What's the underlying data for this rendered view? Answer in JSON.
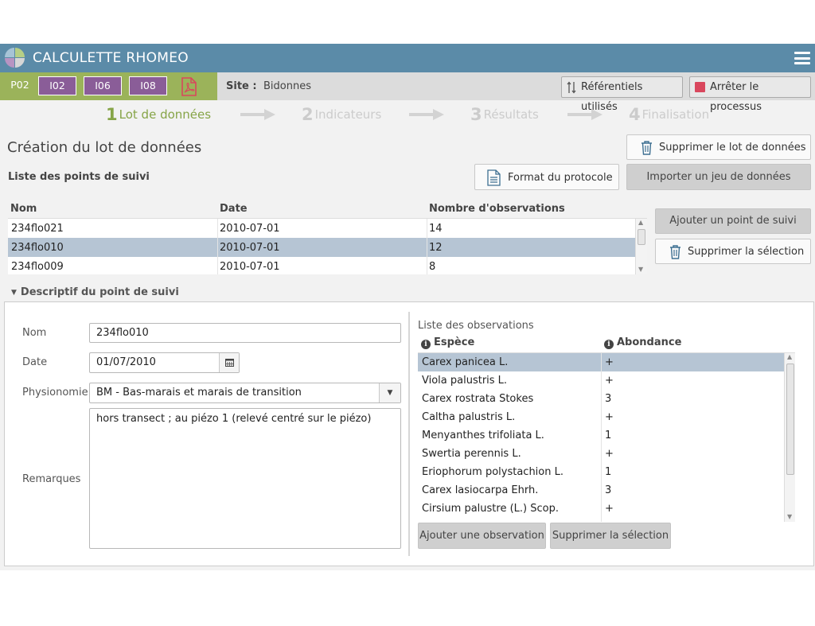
{
  "app": {
    "title": "CALCULETTE RHOMEO"
  },
  "toolbar": {
    "site_code": "P02",
    "indicators": [
      "I02",
      "I06",
      "I08"
    ],
    "site_label": "Site :",
    "site_value": "Bidonnes",
    "referentiels_label": "Référentiels utilisés",
    "stop_label": "Arrêter le processus"
  },
  "steps": [
    {
      "num": "1",
      "label": "Lot de données",
      "active": true
    },
    {
      "num": "2",
      "label": "Indicateurs",
      "active": false
    },
    {
      "num": "3",
      "label": "Résultats",
      "active": false
    },
    {
      "num": "4",
      "label": "Finalisation",
      "active": false
    }
  ],
  "page": {
    "title": "Création du lot de données",
    "delete_lot_label": "Supprimer le lot de données",
    "list_title": "Liste des points de suivi",
    "format_label": "Format du protocole",
    "import_label": "Importer un jeu de données",
    "add_point_label": "Ajouter un point de suivi",
    "delete_selection_label": "Supprimer la sélection"
  },
  "table": {
    "columns": [
      "Nom",
      "Date",
      "Nombre d'observations"
    ],
    "rows": [
      {
        "nom": "234flo021",
        "date": "2010-07-01",
        "nb": "14"
      },
      {
        "nom": "234flo010",
        "date": "2010-07-01",
        "nb": "12"
      },
      {
        "nom": "234flo009",
        "date": "2010-07-01",
        "nb": "8"
      }
    ],
    "selected_index": 1
  },
  "descriptif": {
    "title": "Descriptif du point de suivi",
    "nom_label": "Nom",
    "nom_value": "234flo010",
    "date_label": "Date",
    "date_value": "01/07/2010",
    "physio_label": "Physionomie",
    "physio_value": "BM - Bas-marais et marais de transition",
    "remarques_label": "Remarques",
    "remarques_value": "hors transect ; au piézo 1 (relevé centré sur le piézo)"
  },
  "observations": {
    "title": "Liste des observations",
    "col_espece": "Espèce",
    "col_abondance": "Abondance",
    "rows": [
      {
        "espece": "Carex panicea L.",
        "abondance": "+"
      },
      {
        "espece": "Viola palustris L.",
        "abondance": "+"
      },
      {
        "espece": "Carex rostrata Stokes",
        "abondance": "3"
      },
      {
        "espece": "Caltha palustris L.",
        "abondance": "+"
      },
      {
        "espece": "Menyanthes trifoliata L.",
        "abondance": "1"
      },
      {
        "espece": "Swertia perennis L.",
        "abondance": "+"
      },
      {
        "espece": "Eriophorum polystachion L.",
        "abondance": "1"
      },
      {
        "espece": "Carex lasiocarpa Ehrh.",
        "abondance": "3"
      },
      {
        "espece": "Cirsium palustre (L.) Scop.",
        "abondance": "+"
      }
    ],
    "selected_index": 0,
    "add_label": "Ajouter une observation",
    "delete_label": "Supprimer la sélection"
  },
  "colors": {
    "titlebar": "#5b8ba8",
    "site_block": "#9bb35a",
    "indicator": "#8a5d98",
    "step_active": "#86a447",
    "selection": "#b6c5d4",
    "stop": "#d9475d"
  }
}
